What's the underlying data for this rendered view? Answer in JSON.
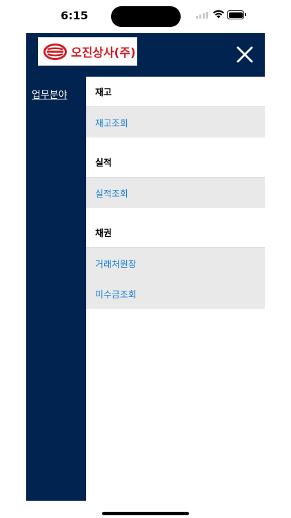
{
  "status_bar": {
    "time": "6:15"
  },
  "header": {
    "logo_text": "오진상사(주)",
    "close_icon": "close-icon"
  },
  "sidebar": {
    "link_label": "업무분야"
  },
  "sections": [
    {
      "title": "재고",
      "items": [
        "재고조회"
      ]
    },
    {
      "title": "실적",
      "items": [
        "실적조회"
      ]
    },
    {
      "title": "채권",
      "items": [
        "거래처원장",
        "미수금조회"
      ]
    }
  ],
  "colors": {
    "navy": "#012350",
    "link_blue": "#1a7fd4",
    "logo_red": "#d01c24",
    "item_bg": "#e9e9e9"
  }
}
